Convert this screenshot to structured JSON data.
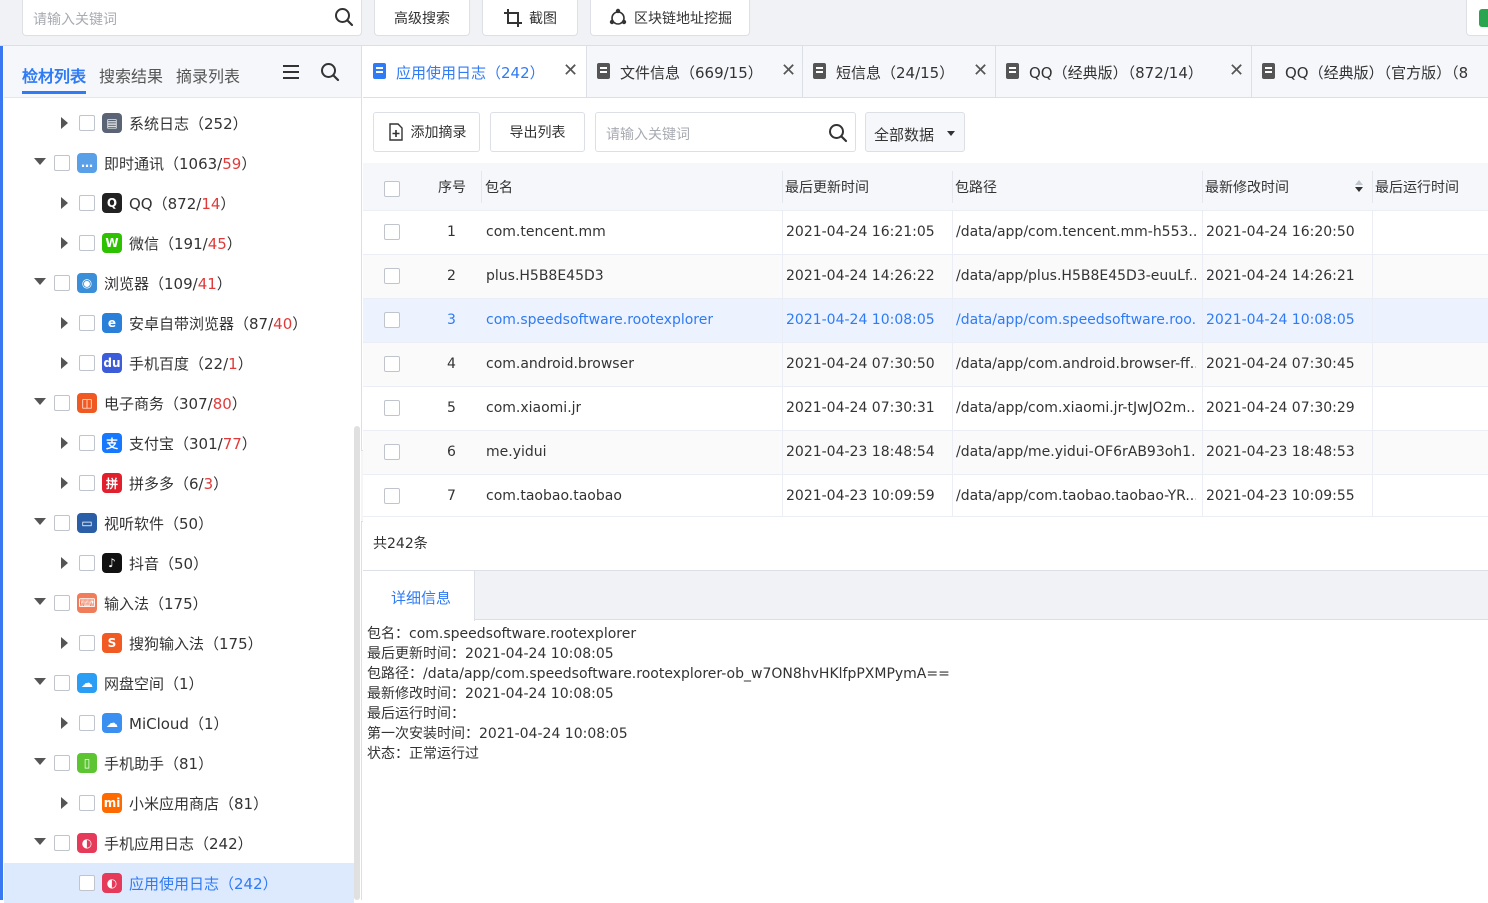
{
  "topbar": {
    "search_placeholder": "请输入关键词",
    "buttons": [
      {
        "label": "高级搜索"
      },
      {
        "label": "截图"
      },
      {
        "label": "区块链地址挖掘"
      }
    ]
  },
  "sidebar": {
    "tabs": [
      "检材列表",
      "搜索结果",
      "摘录列表"
    ],
    "active_tab": "检材列表",
    "tree": [
      {
        "label": "系统日志（252）",
        "level": 1,
        "expanded": false,
        "icon": "system-log-icon"
      },
      {
        "label": "即时通讯（1063/",
        "red": "59",
        "suffix": "）",
        "level": 0,
        "expanded": true,
        "icon": "chat-icon"
      },
      {
        "label": "QQ（872/",
        "red": "14",
        "suffix": "）",
        "level": 1,
        "expanded": false,
        "icon": "qq-icon"
      },
      {
        "label": "微信（191/",
        "red": "45",
        "suffix": "）",
        "level": 1,
        "expanded": false,
        "icon": "wechat-icon"
      },
      {
        "label": "浏览器（109/",
        "red": "41",
        "suffix": "）",
        "level": 0,
        "expanded": true,
        "icon": "globe-icon"
      },
      {
        "label": "安卓自带浏览器（87/",
        "red": "40",
        "suffix": "）",
        "level": 1,
        "expanded": false,
        "icon": "ie-icon"
      },
      {
        "label": "手机百度（22/",
        "red": "1",
        "suffix": "）",
        "level": 1,
        "expanded": false,
        "icon": "baidu-icon"
      },
      {
        "label": "电子商务（307/",
        "red": "80",
        "suffix": "）",
        "level": 0,
        "expanded": true,
        "icon": "shop-icon"
      },
      {
        "label": "支付宝（301/",
        "red": "77",
        "suffix": "）",
        "level": 1,
        "expanded": false,
        "icon": "alipay-icon"
      },
      {
        "label": "拼多多（6/",
        "red": "3",
        "suffix": "）",
        "level": 1,
        "expanded": false,
        "icon": "pinduoduo-icon"
      },
      {
        "label": "视听软件（50）",
        "level": 0,
        "expanded": true,
        "icon": "monitor-icon"
      },
      {
        "label": "抖音（50）",
        "level": 1,
        "expanded": false,
        "icon": "douyin-icon"
      },
      {
        "label": "输入法（175）",
        "level": 0,
        "expanded": true,
        "icon": "keyboard-icon"
      },
      {
        "label": "搜狗输入法（175）",
        "level": 1,
        "expanded": false,
        "icon": "sogou-icon"
      },
      {
        "label": "网盘空间（1）",
        "level": 0,
        "expanded": true,
        "icon": "cloud-icon"
      },
      {
        "label": "MiCloud（1）",
        "level": 1,
        "expanded": false,
        "icon": "micloud-icon"
      },
      {
        "label": "手机助手（81）",
        "level": 0,
        "expanded": true,
        "icon": "phone-icon"
      },
      {
        "label": "小米应用商店（81）",
        "level": 1,
        "expanded": false,
        "icon": "mi-store-icon"
      },
      {
        "label": "手机应用日志（242）",
        "level": 0,
        "expanded": true,
        "icon": "app-log-icon"
      },
      {
        "label": "应用使用日志（242）",
        "level": 1,
        "expanded": null,
        "icon": "app-log-icon",
        "selected": true
      }
    ]
  },
  "main_tabs": [
    {
      "label": "应用使用日志（242）",
      "active": true
    },
    {
      "label": "文件信息（669/15）"
    },
    {
      "label": "短信息（24/15）"
    },
    {
      "label": "QQ（经典版）（872/14）"
    },
    {
      "label": "QQ（经典版）（官方版）（8"
    }
  ],
  "toolbar": {
    "add_excerpt": "添加摘录",
    "export_list": "导出列表",
    "search_placeholder": "请输入关键词",
    "filter_value": "全部数据"
  },
  "table": {
    "headers": [
      "序号",
      "包名",
      "最后更新时间",
      "包路径",
      "最新修改时间",
      "最后运行时间"
    ],
    "rows": [
      {
        "no": "1",
        "pkg": "com.tencent.mm",
        "updated": "2021-04-24 16:21:05",
        "path": "/data/app/com.tencent.mm-h553...",
        "modified": "2021-04-24 16:20:50",
        "last_run": ""
      },
      {
        "no": "2",
        "pkg": "plus.H5B8E45D3",
        "updated": "2021-04-24 14:26:22",
        "path": "/data/app/plus.H5B8E45D3-euuLf...",
        "modified": "2021-04-24 14:26:21",
        "last_run": ""
      },
      {
        "no": "3",
        "pkg": "com.speedsoftware.rootexplorer",
        "updated": "2021-04-24 10:08:05",
        "path": "/data/app/com.speedsoftware.roo...",
        "modified": "2021-04-24 10:08:05",
        "last_run": "",
        "selected": true
      },
      {
        "no": "4",
        "pkg": "com.android.browser",
        "updated": "2021-04-24 07:30:50",
        "path": "/data/app/com.android.browser-ff...",
        "modified": "2021-04-24 07:30:45",
        "last_run": ""
      },
      {
        "no": "5",
        "pkg": "com.xiaomi.jr",
        "updated": "2021-04-24 07:30:31",
        "path": "/data/app/com.xiaomi.jr-tJwJO2m...",
        "modified": "2021-04-24 07:30:29",
        "last_run": ""
      },
      {
        "no": "6",
        "pkg": "me.yidui",
        "updated": "2021-04-23 18:48:54",
        "path": "/data/app/me.yidui-OF6rAB93oh1...",
        "modified": "2021-04-23 18:48:53",
        "last_run": ""
      },
      {
        "no": "7",
        "pkg": "com.taobao.taobao",
        "updated": "2021-04-23 10:09:59",
        "path": "/data/app/com.taobao.taobao-YR...",
        "modified": "2021-04-23 10:09:55",
        "last_run": ""
      }
    ],
    "total": "共242条"
  },
  "detail": {
    "tab": "详细信息",
    "lines": [
      "包名：com.speedsoftware.rootexplorer",
      "最后更新时间：2021-04-24 10:08:05",
      "包路径：/data/app/com.speedsoftware.rootexplorer-ob_w7ON8hvHKlfpPXMPymA==",
      "最新修改时间：2021-04-24 10:08:05",
      "最后运行时间：",
      "第一次安装时间：2021-04-24 10:08:05",
      "状态：正常运行过"
    ]
  },
  "colors": {
    "accent": "#2f7bf5",
    "red_count": "#e03b3b",
    "selected_row_bg": "#ecf3fe",
    "selected_tree_bg": "#dde9fd"
  }
}
